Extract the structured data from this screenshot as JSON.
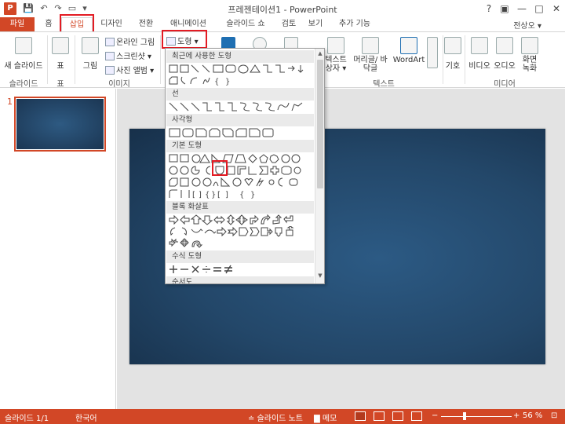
{
  "titlebar": {
    "app_icon": "P",
    "title": "프레젠테이션1 - PowerPoint",
    "help": "?",
    "restore": "▣",
    "minimize": "—",
    "maximize": "□",
    "close": "✕",
    "qat_save": "💾",
    "qat_undo": "↶",
    "qat_redo": "↷",
    "qat_present": "▭",
    "qat_more": "▾"
  },
  "tabs": {
    "file": "파일",
    "home": "홈",
    "insert": "삽입",
    "design": "디자인",
    "transitions": "전환",
    "animations": "애니메이션",
    "slideshow": "슬라이드 쇼",
    "review": "검토",
    "view": "보기",
    "addins": "추가 기능",
    "user": "전상오 ▾"
  },
  "ribbon": {
    "new_slide": "새 슬라이드",
    "table": "표",
    "picture": "그림",
    "online_picture": "온라인 그림",
    "screenshot": "스크린샷 ▾",
    "photo_album": "사진 앨범 ▾",
    "shapes": "도형 ▾",
    "textbox": "텍스트 상자 ▾",
    "header_footer": "머리글/ 바닥글",
    "wordart": "WordArt",
    "symbol": "기호",
    "video": "비디오",
    "audio": "오디오",
    "screen_record": "화면 녹화",
    "groups": {
      "slides": "슬라이드",
      "tables": "표",
      "images": "이미지",
      "text": "텍스트",
      "media": "미디어"
    }
  },
  "shapes_menu": {
    "categories": {
      "recent": "최근에 사용한 도형",
      "lines": "선",
      "rectangles": "사각형",
      "basic": "기본 도형",
      "block_arrows": "블록 화살표",
      "equation": "수식 도형",
      "flowchart": "순서도"
    },
    "scroll_up": "▲",
    "scroll_down": "▼"
  },
  "left_pane": {
    "slide_number": "1"
  },
  "statusbar": {
    "slide_info": "슬라이드 1/1",
    "language": "한국어",
    "notes": "≐ 슬라이드 노트",
    "comments": "▇ 메모",
    "zoom_minus": "−",
    "zoom_plus": "+",
    "zoom": "56 %",
    "fit": "⊡"
  },
  "colors": {
    "accent": "#d24726",
    "highlight_box": "#e31b23",
    "slide_bg": "#234769"
  }
}
